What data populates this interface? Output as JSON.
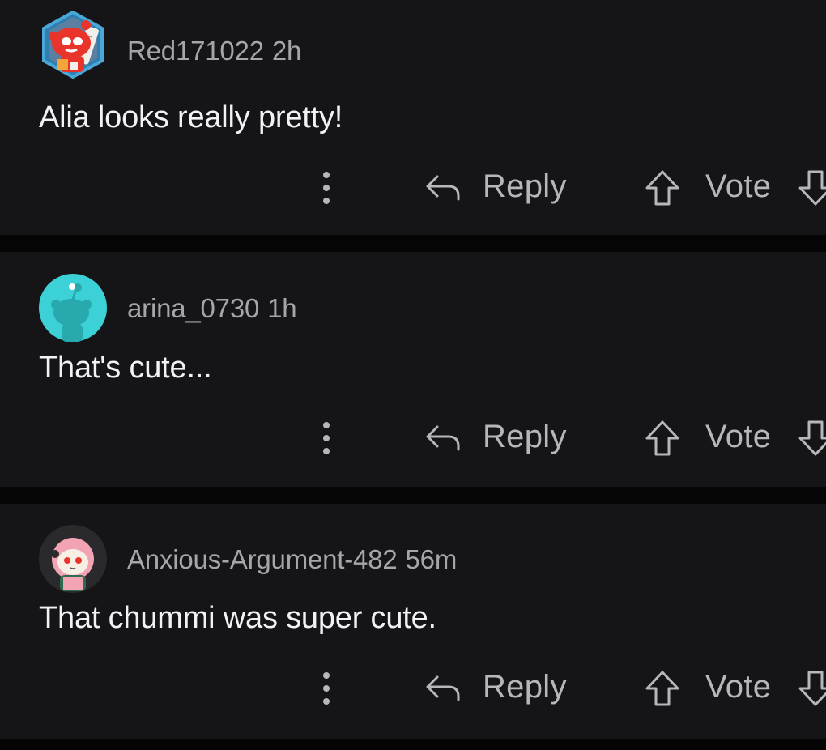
{
  "comments": [
    {
      "username": "Red171022",
      "time": "2h",
      "text": "Alia looks really pretty!",
      "avatar_icon": "red-snoo-avatar-icon"
    },
    {
      "username": "arina_0730",
      "time": "1h",
      "text": "That's cute...",
      "avatar_icon": "default-snoo-avatar-icon"
    },
    {
      "username": "Anxious-Argument-482",
      "time": "56m",
      "text": "That chummi was super cute.",
      "avatar_icon": "pink-hood-snoo-avatar-icon"
    }
  ],
  "actions": {
    "reply_label": "Reply",
    "vote_label": "Vote",
    "more_icon": "more-vertical-icon",
    "reply_icon": "reply-arrow-icon",
    "upvote_icon": "upvote-arrow-icon",
    "downvote_icon": "downvote-arrow-icon"
  },
  "colors": {
    "background": "#050506",
    "card": "#151517",
    "text": "#f2f2f4",
    "muted": "#a6a6aa",
    "avatar_teal": "#3cd1d6",
    "avatar_red": "#e8342a"
  }
}
